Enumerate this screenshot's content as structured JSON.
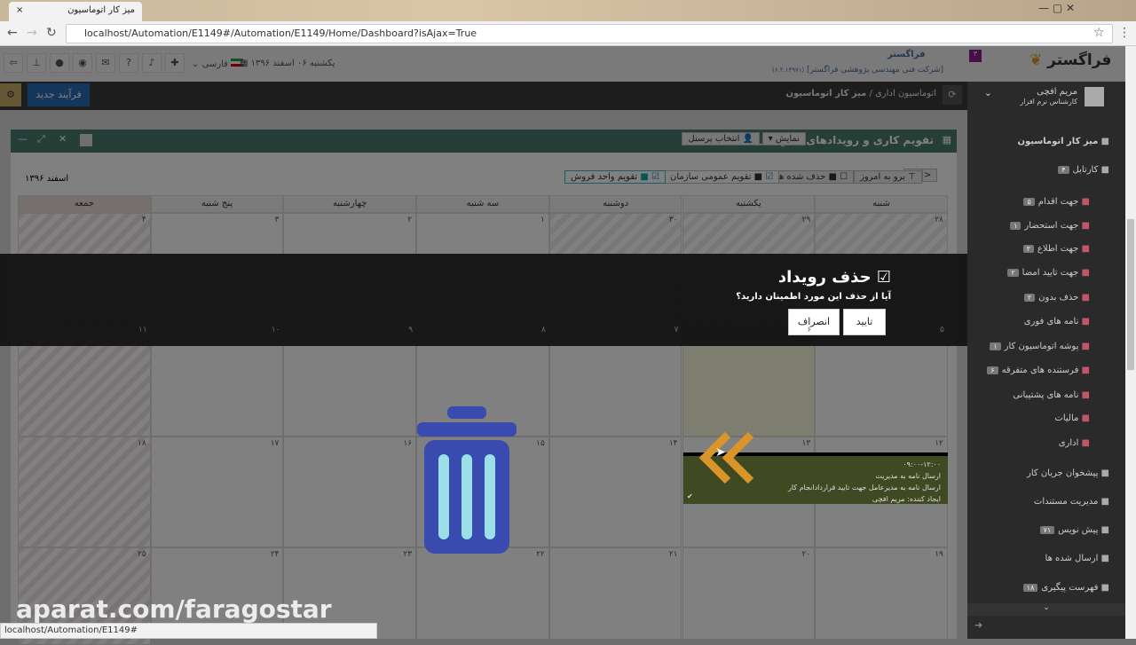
{
  "browser": {
    "tab_title": "میز کار اتوماسیون",
    "url": "localhost/Automation/E1149#/Automation/E1149/Home/Dashboard?isAjax=True",
    "status_url": "localhost/Automation/E1149#"
  },
  "header": {
    "logo": "فراگستر",
    "company_name": "فراگستر",
    "company_full": "[شرکت فنی مهندسی پژوهشی فراگستر]",
    "version": "(۶.۲.۱۳۹۷۱)",
    "notif_count": "۳",
    "date": "یکشنبه ۰۶ اسفند ۱۳۹۶",
    "language": "فارسی"
  },
  "darkbar": {
    "new_process": "فرآیند جدید",
    "breadcrumb": [
      "اتوماسیون اداری",
      "میز کار اتوماسیون"
    ]
  },
  "user": {
    "name": "مریم افچی",
    "role": "کارشناس نرم افزار"
  },
  "sidebar": {
    "items": [
      {
        "label": "میز کار اتوماسیون",
        "badge": ""
      },
      {
        "label": "کارتابل",
        "badge": "۴"
      },
      {
        "label": "جهت اقدام",
        "badge": "۵"
      },
      {
        "label": "جهت استحضار",
        "badge": "۱"
      },
      {
        "label": "جهت اطلاع",
        "badge": "۳"
      },
      {
        "label": "جهت تایید امضا",
        "badge": "۲"
      },
      {
        "label": "حذف بدون",
        "badge": "۲"
      },
      {
        "label": "نامه های فوری",
        "badge": ""
      },
      {
        "label": "پوشه اتوماسیون کار",
        "badge": "۱"
      },
      {
        "label": "فرستنده های متفرقه",
        "badge": "۶"
      },
      {
        "label": "نامه های پشتیبانی",
        "badge": ""
      },
      {
        "label": "مالیات",
        "badge": ""
      },
      {
        "label": "اداری",
        "badge": ""
      },
      {
        "label": "پیشخوان جریان کار",
        "badge": ""
      },
      {
        "label": "مدیریت مستندات",
        "badge": ""
      },
      {
        "label": "پیش نویس",
        "badge": "۷۱"
      },
      {
        "label": "ارسال شده ها",
        "badge": ""
      },
      {
        "label": "فهرست پیگیری",
        "badge": "۱۸"
      }
    ]
  },
  "calendar": {
    "title": "تقویم کاری و رویدادهای سازمانی",
    "show": "نمایش",
    "select_personnel": "انتخاب پرسنل",
    "month": "اسفند ۱۳۹۶",
    "today": "برو به امروز",
    "deleted": "حذف شده ها",
    "org_calendar": "تقویم عمومی سازمان",
    "sales_calendar": "تقویم واحد فروش",
    "days": [
      "شنبه",
      "یکشنبه",
      "دوشنبه",
      "سه شنبه",
      "چهارشنبه",
      "پنج شنبه",
      "جمعه"
    ],
    "weeks": [
      [
        "۲۸",
        "۲۹",
        "۳۰",
        "۱",
        "۲",
        "۳",
        "۴"
      ],
      [
        "۵",
        "۶",
        "۷",
        "۸",
        "۹",
        "۱۰",
        "۱۱"
      ],
      [
        "۱۲",
        "۱۳",
        "۱۴",
        "۱۵",
        "۱۶",
        "۱۷",
        "۱۸"
      ],
      [
        "۱۹",
        "۲۰",
        "۲۱",
        "۲۲",
        "۲۳",
        "۲۴",
        "۲۵"
      ]
    ],
    "event": {
      "time": "۰۹:۰۰-۱۲:۰۰",
      "title": "ارسال نامه به مدیریت",
      "desc": "ارسال نامه به مدیرعامل جهت تایید قراردادانجام کار",
      "creator": "ایجاد کننده: مریم افچی"
    }
  },
  "modal": {
    "title": "حذف رویداد",
    "message": "آیا از حذف این مورد اطمینان دارید؟",
    "confirm": "تایید",
    "cancel": "انصراف"
  },
  "watermark": "aparat.com/faragostar"
}
